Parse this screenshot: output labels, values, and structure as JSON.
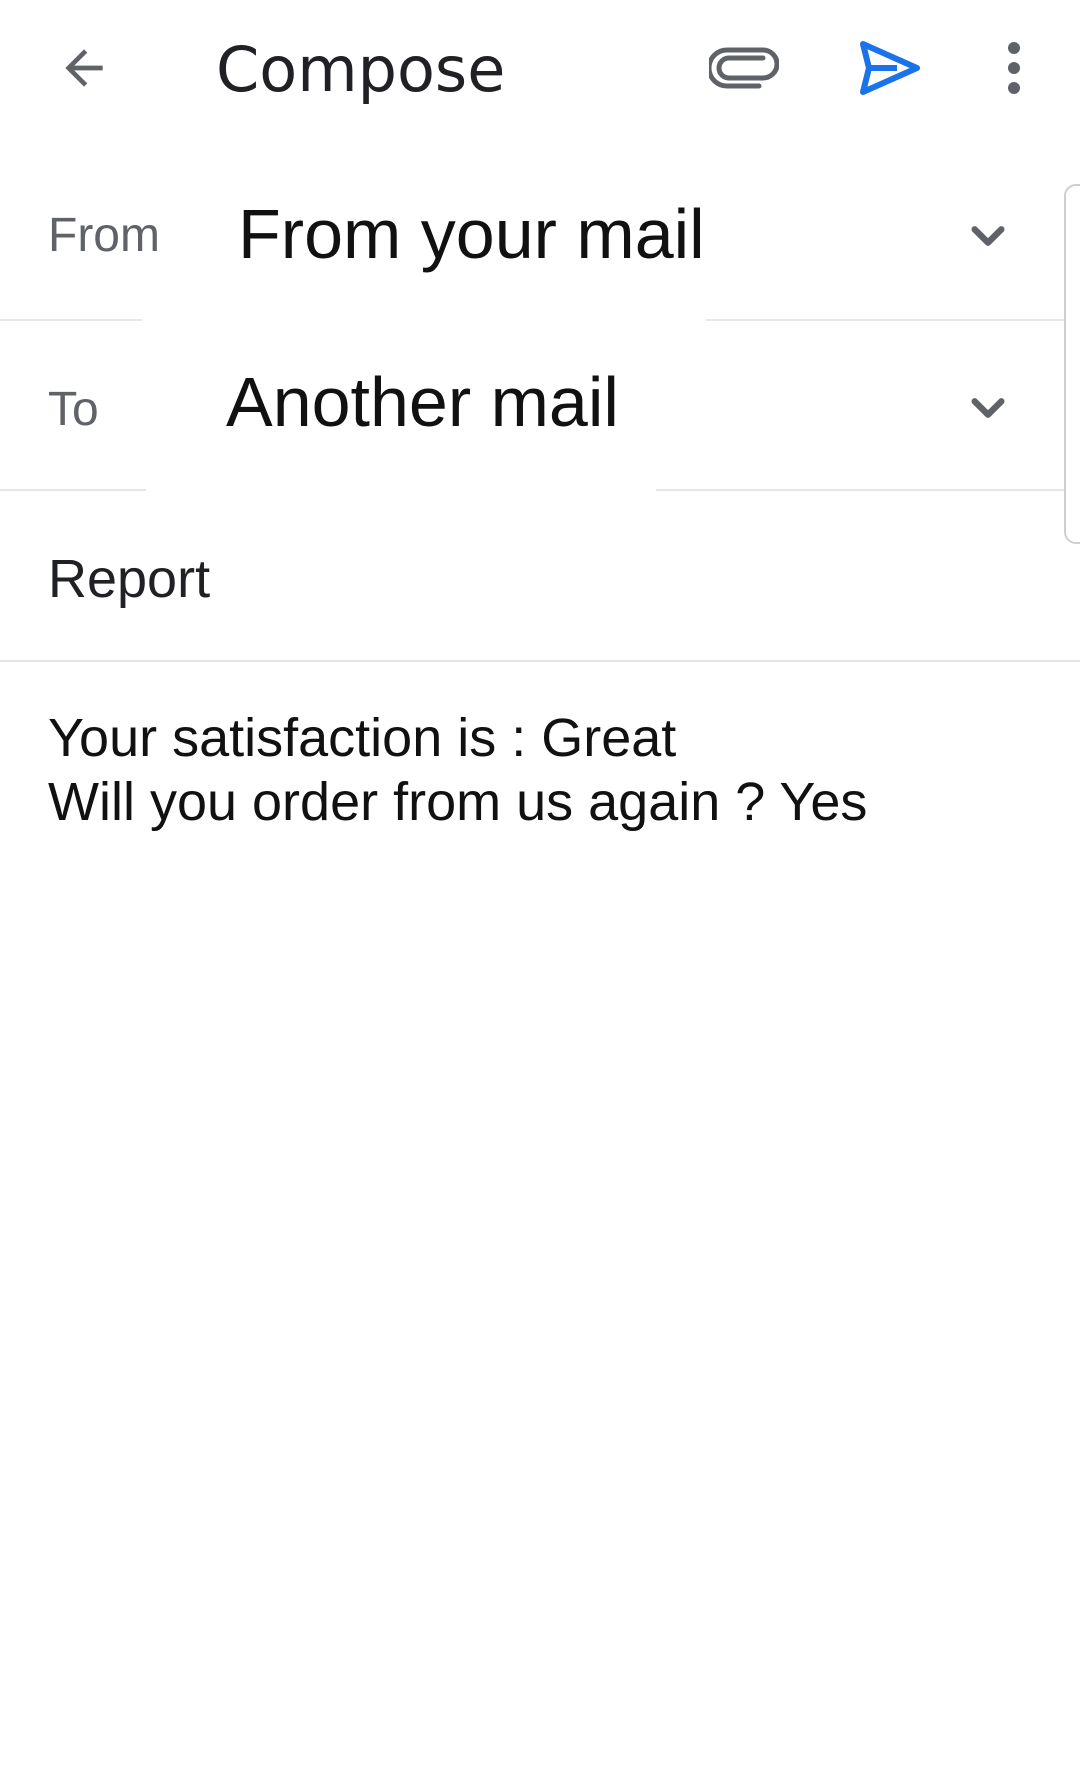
{
  "appbar": {
    "title": "Compose",
    "icons": {
      "back": "arrow-back-icon",
      "attach": "paperclip-icon",
      "send": "send-icon",
      "more": "more-vertical-icon"
    },
    "send_color": "#1a73e8"
  },
  "from": {
    "label": "From",
    "value": "From your mail"
  },
  "to": {
    "label": "To",
    "value": "Another mail"
  },
  "subject": "Report",
  "body": {
    "lines": [
      "Your satisfaction is : Great",
      "Will you order from us again ? Yes"
    ]
  }
}
